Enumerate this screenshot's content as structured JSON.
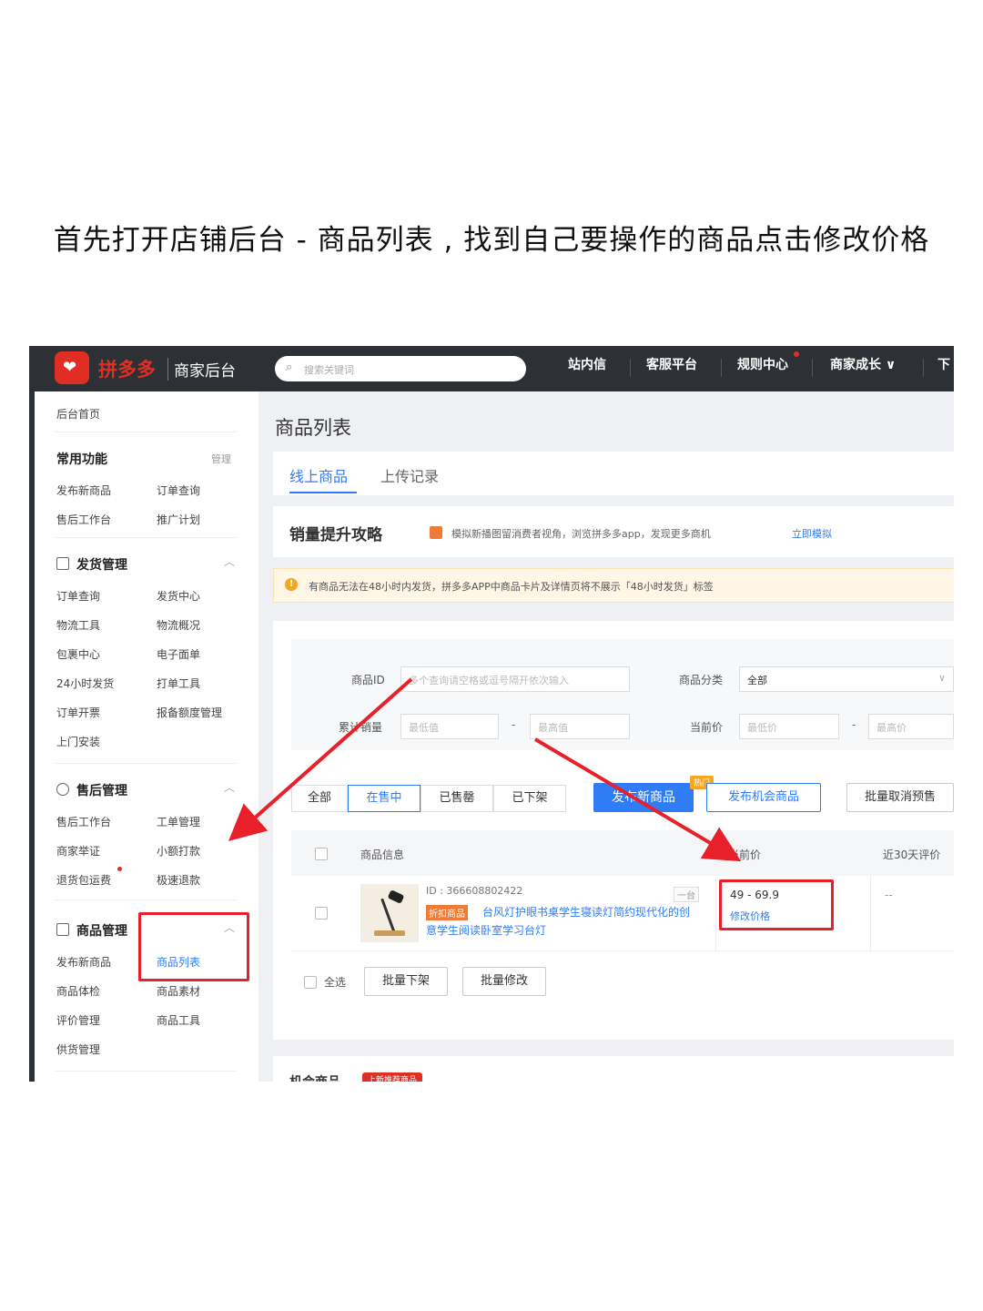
{
  "caption": "首先打开店铺后台 - 商品列表 , 找到自己要操作的商品点击修改价格",
  "colors": {
    "brand_red": "#e02e24",
    "accent_blue": "#2f7cf6",
    "topbar": "#2d3035",
    "highlight_red": "#e8202a"
  },
  "topbar": {
    "brand": "拼多多",
    "brand_sub": "商家后台",
    "search_placeholder": "搜索关键词",
    "nav": [
      "站内信",
      "客服平台",
      "规则中心",
      "商家成长 ∨",
      "下"
    ]
  },
  "sidebar": {
    "home": "后台首页",
    "common": {
      "title": "常用功能",
      "manage": "管理",
      "items": [
        "发布新商品",
        "订单查询",
        "售后工作台",
        "推广计划"
      ]
    },
    "shipping": {
      "title": "发货管理",
      "items": [
        "订单查询",
        "发货中心",
        "物流工具",
        "物流概况",
        "包裹中心",
        "电子面单",
        "24小时发货",
        "打单工具",
        "订单开票",
        "报备额度管理",
        "上门安装"
      ]
    },
    "aftersale": {
      "title": "售后管理",
      "items": [
        "售后工作台",
        "工单管理",
        "商家举证",
        "小额打款",
        "退货包运费",
        "极速退款"
      ]
    },
    "goods": {
      "title": "商品管理",
      "items": [
        "发布新商品",
        "商品列表",
        "商品体检",
        "商品素材",
        "评价管理",
        "商品工具",
        "供货管理"
      ]
    }
  },
  "main": {
    "page_title": "商品列表",
    "tabs": [
      "线上商品",
      "上传记录"
    ],
    "promo": {
      "title": "销量提升攻略",
      "text": "模拟新播图留消费者视角，浏览拼多多app，发现更多商机",
      "link": "立即模拟"
    },
    "warning": "有商品无法在48小时内发货，拼多多APP中商品卡片及详情页将不展示「48小时发货」标签",
    "filters": {
      "goods_id_label": "商品ID",
      "goods_id_placeholder": "多个查询请空格或逗号隔开依次输入",
      "category_label": "商品分类",
      "category_value": "全部",
      "sales_label": "累计销量",
      "min_placeholder": "最低值",
      "max_placeholder": "最高值",
      "price_label": "当前价",
      "min_price_placeholder": "最低价",
      "max_price_placeholder": "最高价"
    },
    "status_tabs": [
      "全部",
      "在售中",
      "已售罄",
      "已下架"
    ],
    "buttons": {
      "publish_new": "发布新商品",
      "publish_chance": "发布机会商品",
      "hot_tag": "热门",
      "batch_cancel": "批量取消预售"
    },
    "table": {
      "headers": [
        "商品信息",
        "当前价",
        "近30天评价"
      ],
      "row": {
        "id": "ID : 366608802422",
        "tag": "折扣商品",
        "title": "台风灯护眼书桌学生寝读灯简约现代化的创意学生阅读卧室学习台灯",
        "mini_tag": "一台",
        "price": "49 - 69.9",
        "edit_price": "修改价格",
        "reviews": "--"
      }
    },
    "footer": {
      "select_all": "全选",
      "batch_off": "批量下架",
      "batch_edit": "批量修改"
    },
    "chance": {
      "title": "机会商品",
      "badge": "上新推荐商品"
    }
  }
}
